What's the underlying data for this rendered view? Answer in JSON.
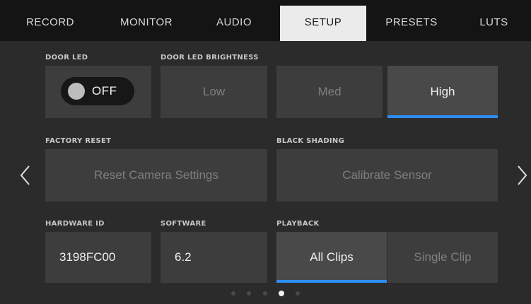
{
  "tabs": [
    {
      "label": "RECORD"
    },
    {
      "label": "MONITOR"
    },
    {
      "label": "AUDIO"
    },
    {
      "label": "SETUP"
    },
    {
      "label": "PRESETS"
    },
    {
      "label": "LUTS"
    }
  ],
  "active_tab": "SETUP",
  "door_led": {
    "label": "DOOR LED",
    "state": "OFF"
  },
  "door_led_brightness": {
    "label": "DOOR LED BRIGHTNESS",
    "options": [
      "Low",
      "Med",
      "High"
    ],
    "selected": "High"
  },
  "factory_reset": {
    "label": "FACTORY RESET",
    "button": "Reset Camera Settings"
  },
  "black_shading": {
    "label": "BLACK SHADING",
    "button": "Calibrate Sensor"
  },
  "hardware_id": {
    "label": "HARDWARE ID",
    "value": "3198FC00"
  },
  "software": {
    "label": "SOFTWARE",
    "value": "6.2"
  },
  "playback": {
    "label": "PLAYBACK",
    "options": [
      "All Clips",
      "Single Clip"
    ],
    "selected": "All Clips"
  },
  "pagination": {
    "total": 5,
    "current": 4
  },
  "colors": {
    "accent": "#2d8cf0",
    "panel": "#3d3d3d",
    "background": "#2b2b2b",
    "tab_active": "#ebebeb"
  }
}
